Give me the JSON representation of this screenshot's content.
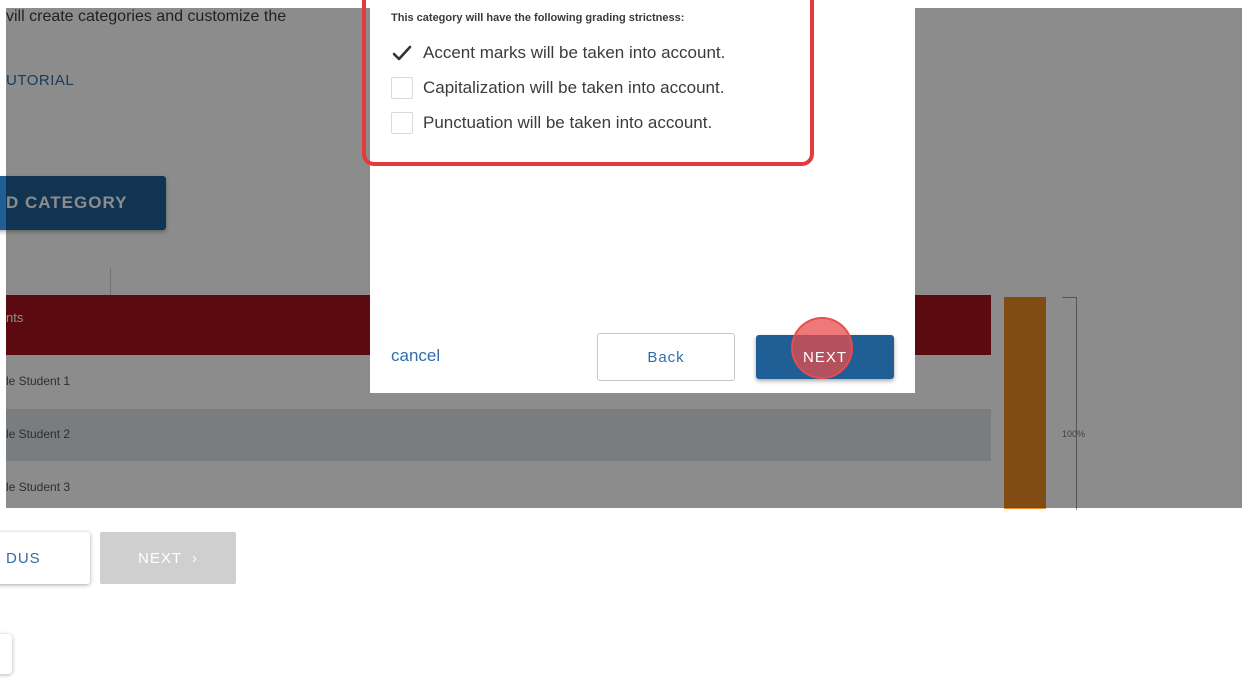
{
  "background": {
    "intro_text": "vill create categories and customize the",
    "tutorial_link": "UTORIAL",
    "add_category_button": "D CATEGORY",
    "table_header": "nts",
    "students": [
      "le Student 1",
      "le Student 2",
      "le Student 3"
    ],
    "percent_label": "100%",
    "previous_button": "DUS",
    "next_button": "NEXT",
    "next_chevron": "›"
  },
  "modal": {
    "strictness_heading": "This category will have the following grading strictness:",
    "options": [
      {
        "label": "Accent marks will be taken into account.",
        "checked": true
      },
      {
        "label": "Capitalization will be taken into account.",
        "checked": false
      },
      {
        "label": "Punctuation will be taken into account.",
        "checked": false
      }
    ],
    "cancel_label": "cancel",
    "back_label": "Back",
    "next_label": "NEXT"
  },
  "colors": {
    "primary": "#1f5f96",
    "link": "#2f6fa6",
    "table_header": "#a7151c",
    "highlight": "#e53a3a",
    "bar": "#ec8a26"
  }
}
